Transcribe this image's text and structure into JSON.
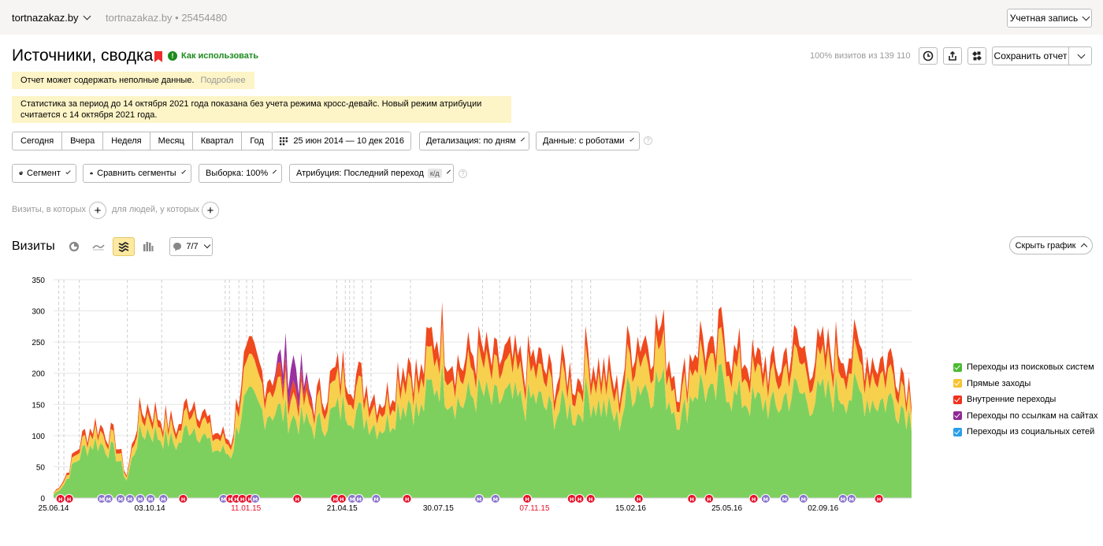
{
  "header": {
    "site": "tortnazakaz.by",
    "site_meta": "tortnazakaz.by • 25454480",
    "account": "Учетная запись"
  },
  "page": {
    "title": "Источники, сводка",
    "howto": "Как использовать",
    "visits_pct": "100% визитов из 139 110",
    "save": "Сохранить отчет"
  },
  "notices": {
    "incomplete": "Отчет может содержать неполные данные.",
    "more": "Подробнее",
    "cross_device": "Статистика за период до 14 октября 2021 года показана без учета режима кросс-девайс. Новый режим атрибуции считается с 14 октября 2021 года."
  },
  "periods": [
    "Сегодня",
    "Вчера",
    "Неделя",
    "Месяц",
    "Квартал",
    "Год"
  ],
  "filters": {
    "date_range": "25 июн 2014 — 10 дек 2016",
    "detail": "Детализация: по дням",
    "data": "Данные: с роботами",
    "segment": "Сегмент",
    "compare": "Сравнить сегменты",
    "sample": "Выборка: 100%",
    "attribution": "Атрибуция: Последний переход",
    "kd": "к/д",
    "visits_where": "Визиты, в которых",
    "people_where": "для людей, у которых"
  },
  "chart_header": {
    "title": "Визиты",
    "notes": "7/7",
    "hide": "Скрыть график"
  },
  "colors": {
    "green": "#7ed05e",
    "yellow": "#f7d04e",
    "red": "#f0491e",
    "purple": "#9b30a0",
    "blue": "#2b9ee8",
    "note_red": "#e8122b",
    "note_purple": "#8b76cc"
  },
  "chart_data": {
    "type": "area",
    "stacked": true,
    "title": "",
    "xlabel": "",
    "ylabel": "",
    "ylim": [
      0,
      350
    ],
    "yticks": [
      0,
      50,
      100,
      150,
      200,
      250,
      300,
      350
    ],
    "x_range": [
      "25.06.14",
      "10.12.16"
    ],
    "x_ticks": [
      {
        "label": "25.06.14",
        "highlight": false
      },
      {
        "label": "03.10.14",
        "highlight": false
      },
      {
        "label": "11.01.15",
        "highlight": true
      },
      {
        "label": "21.04.15",
        "highlight": false
      },
      {
        "label": "30.07.15",
        "highlight": false
      },
      {
        "label": "07.11.15",
        "highlight": true
      },
      {
        "label": "15.02.16",
        "highlight": false
      },
      {
        "label": "25.05.16",
        "highlight": false
      },
      {
        "label": "02.09.16",
        "highlight": false
      }
    ],
    "legend_position": "right",
    "series": [
      {
        "name": "Переходы из поисковых систем",
        "color": "#7ed05e",
        "values": [
          5,
          22,
          55,
          80,
          90,
          82,
          70,
          28,
          95,
          110,
          100,
          92,
          85,
          120,
          110,
          80,
          75,
          70,
          145,
          150,
          138,
          142,
          135,
          128,
          120,
          112,
          125,
          138,
          148,
          135,
          128,
          115,
          120,
          150,
          160,
          130,
          178,
          190,
          165,
          150,
          165,
          165,
          150,
          160,
          155,
          150,
          160,
          145,
          135,
          150,
          130,
          168,
          150,
          140,
          120,
          175,
          185,
          180,
          190,
          155,
          125,
          170,
          185,
          150,
          200,
          158,
          160,
          150,
          155,
          140,
          165,
          170,
          160,
          160,
          165,
          170,
          168,
          165,
          160,
          155,
          158,
          150,
          130
        ]
      },
      {
        "name": "Прямые заходы",
        "color": "#f7d04e",
        "values": [
          2,
          5,
          10,
          15,
          20,
          18,
          15,
          5,
          22,
          25,
          22,
          20,
          18,
          30,
          28,
          20,
          18,
          15,
          40,
          45,
          40,
          42,
          38,
          35,
          30,
          28,
          35,
          40,
          42,
          38,
          35,
          30,
          30,
          40,
          45,
          35,
          50,
          55,
          45,
          40,
          45,
          45,
          40,
          42,
          40,
          40,
          42,
          38,
          35,
          40,
          35,
          45,
          40,
          38,
          30,
          48,
          50,
          50,
          55,
          42,
          32,
          45,
          50,
          40,
          55,
          42,
          45,
          40,
          42,
          38,
          45,
          48,
          45,
          45,
          45,
          48,
          46,
          45,
          45,
          42,
          43,
          40,
          30
        ]
      },
      {
        "name": "Внутренние переходы",
        "color": "#f0491e",
        "values": [
          1,
          3,
          6,
          9,
          10,
          9,
          8,
          3,
          12,
          14,
          12,
          11,
          10,
          15,
          14,
          10,
          9,
          8,
          22,
          24,
          20,
          22,
          20,
          18,
          16,
          15,
          18,
          20,
          22,
          20,
          18,
          16,
          16,
          22,
          25,
          20,
          28,
          30,
          25,
          22,
          25,
          25,
          22,
          24,
          22,
          22,
          24,
          21,
          20,
          22,
          20,
          25,
          22,
          21,
          18,
          27,
          28,
          28,
          30,
          24,
          18,
          25,
          28,
          22,
          30,
          24,
          25,
          22,
          24,
          21,
          25,
          27,
          25,
          25,
          25,
          27,
          26,
          25,
          25,
          24,
          24,
          22,
          16
        ]
      },
      {
        "name": "Переходы по ссылкам на сайтах",
        "color": "#9b30a0",
        "values": [
          0,
          0,
          0,
          0,
          0,
          0,
          0,
          0,
          0,
          0,
          0,
          0,
          0,
          0,
          0,
          0,
          0,
          0,
          0,
          0,
          0,
          0,
          28,
          40,
          12,
          0,
          0,
          0,
          0,
          0,
          0,
          0,
          0,
          0,
          0,
          0,
          0,
          0,
          0,
          0,
          0,
          0,
          0,
          0,
          0,
          0,
          0,
          0,
          0,
          0,
          0,
          0,
          0,
          0,
          0,
          0,
          0,
          0,
          0,
          0,
          0,
          0,
          0,
          0,
          0,
          0,
          0,
          0,
          0,
          0,
          0,
          0,
          0,
          0,
          0,
          0,
          0,
          0,
          0,
          0,
          0,
          0,
          0
        ]
      },
      {
        "name": "Переходы из социальных сетей",
        "color": "#2b9ee8",
        "values": [
          0,
          0,
          0,
          0,
          0,
          0,
          0,
          0,
          0,
          0,
          0,
          0,
          0,
          0,
          0,
          0,
          0,
          0,
          0,
          0,
          0,
          0,
          0,
          0,
          0,
          0,
          0,
          0,
          0,
          0,
          0,
          0,
          0,
          0,
          0,
          0,
          0,
          0,
          0,
          0,
          0,
          0,
          0,
          0,
          0,
          0,
          0,
          0,
          0,
          0,
          0,
          0,
          0,
          0,
          0,
          0,
          0,
          0,
          0,
          0,
          0,
          0,
          0,
          0,
          0,
          0,
          0,
          0,
          0,
          0,
          0,
          0,
          0,
          0,
          0,
          0,
          0,
          0,
          0,
          0,
          0,
          0,
          0
        ]
      }
    ],
    "annotations": [
      {
        "x": 0.008,
        "type": "holiday",
        "label": "H"
      },
      {
        "x": 0.018,
        "type": "holiday",
        "label": "H"
      },
      {
        "x": 0.056,
        "type": "note",
        "label": "M"
      },
      {
        "x": 0.064,
        "type": "note",
        "label": "M"
      },
      {
        "x": 0.078,
        "type": "note",
        "label": "M"
      },
      {
        "x": 0.089,
        "type": "note",
        "label": "M"
      },
      {
        "x": 0.101,
        "type": "note",
        "label": "M"
      },
      {
        "x": 0.113,
        "type": "note",
        "label": "M"
      },
      {
        "x": 0.128,
        "type": "note",
        "label": "M"
      },
      {
        "x": 0.151,
        "type": "holiday",
        "label": "H"
      },
      {
        "x": 0.198,
        "type": "note",
        "label": "M"
      },
      {
        "x": 0.206,
        "type": "holiday",
        "label": "H"
      },
      {
        "x": 0.213,
        "type": "holiday",
        "label": "H"
      },
      {
        "x": 0.22,
        "type": "holiday",
        "label": "H"
      },
      {
        "x": 0.229,
        "type": "holiday",
        "label": "H"
      },
      {
        "x": 0.235,
        "type": "note",
        "label": "M"
      },
      {
        "x": 0.284,
        "type": "holiday",
        "label": "H"
      },
      {
        "x": 0.328,
        "type": "holiday",
        "label": "H"
      },
      {
        "x": 0.336,
        "type": "holiday",
        "label": "H"
      },
      {
        "x": 0.348,
        "type": "note",
        "label": "M"
      },
      {
        "x": 0.356,
        "type": "note",
        "label": "M"
      },
      {
        "x": 0.376,
        "type": "note",
        "label": "M"
      },
      {
        "x": 0.412,
        "type": "holiday",
        "label": "H"
      },
      {
        "x": 0.496,
        "type": "note",
        "label": "M"
      },
      {
        "x": 0.515,
        "type": "note",
        "label": "M"
      },
      {
        "x": 0.552,
        "type": "holiday",
        "label": "H"
      },
      {
        "x": 0.604,
        "type": "holiday",
        "label": "H"
      },
      {
        "x": 0.613,
        "type": "holiday",
        "label": "H"
      },
      {
        "x": 0.626,
        "type": "holiday",
        "label": "H"
      },
      {
        "x": 0.682,
        "type": "holiday",
        "label": "H"
      },
      {
        "x": 0.744,
        "type": "holiday",
        "label": "H"
      },
      {
        "x": 0.764,
        "type": "holiday",
        "label": "H"
      },
      {
        "x": 0.816,
        "type": "holiday",
        "label": "H"
      },
      {
        "x": 0.83,
        "type": "note",
        "label": "M"
      },
      {
        "x": 0.852,
        "type": "note",
        "label": "M"
      },
      {
        "x": 0.874,
        "type": "note",
        "label": "M"
      },
      {
        "x": 0.92,
        "type": "note",
        "label": "M"
      },
      {
        "x": 0.93,
        "type": "note",
        "label": "M"
      },
      {
        "x": 0.962,
        "type": "holiday",
        "label": "H"
      }
    ],
    "vertical_guides": [
      0.006,
      0.012,
      0.03,
      0.086,
      0.126,
      0.2,
      0.205,
      0.216,
      0.225,
      0.232,
      0.245,
      0.33,
      0.34,
      0.345,
      0.35,
      0.36,
      0.37,
      0.416,
      0.5,
      0.52,
      0.556,
      0.604,
      0.616,
      0.626,
      0.684,
      0.75,
      0.768,
      0.816,
      0.826,
      0.84,
      0.86,
      0.876,
      0.92,
      0.93,
      0.946,
      0.966
    ]
  },
  "legend_items": [
    {
      "label": "Переходы из поисковых систем",
      "color": "#7ed05e"
    },
    {
      "label": "Прямые заходы",
      "color": "#f7d04e"
    },
    {
      "label": "Внутренние переходы",
      "color": "#f0491e"
    },
    {
      "label": "Переходы по ссылкам на сайтах",
      "color": "#9b30a0"
    },
    {
      "label": "Переходы из социальных сетей",
      "color": "#2b9ee8"
    }
  ]
}
